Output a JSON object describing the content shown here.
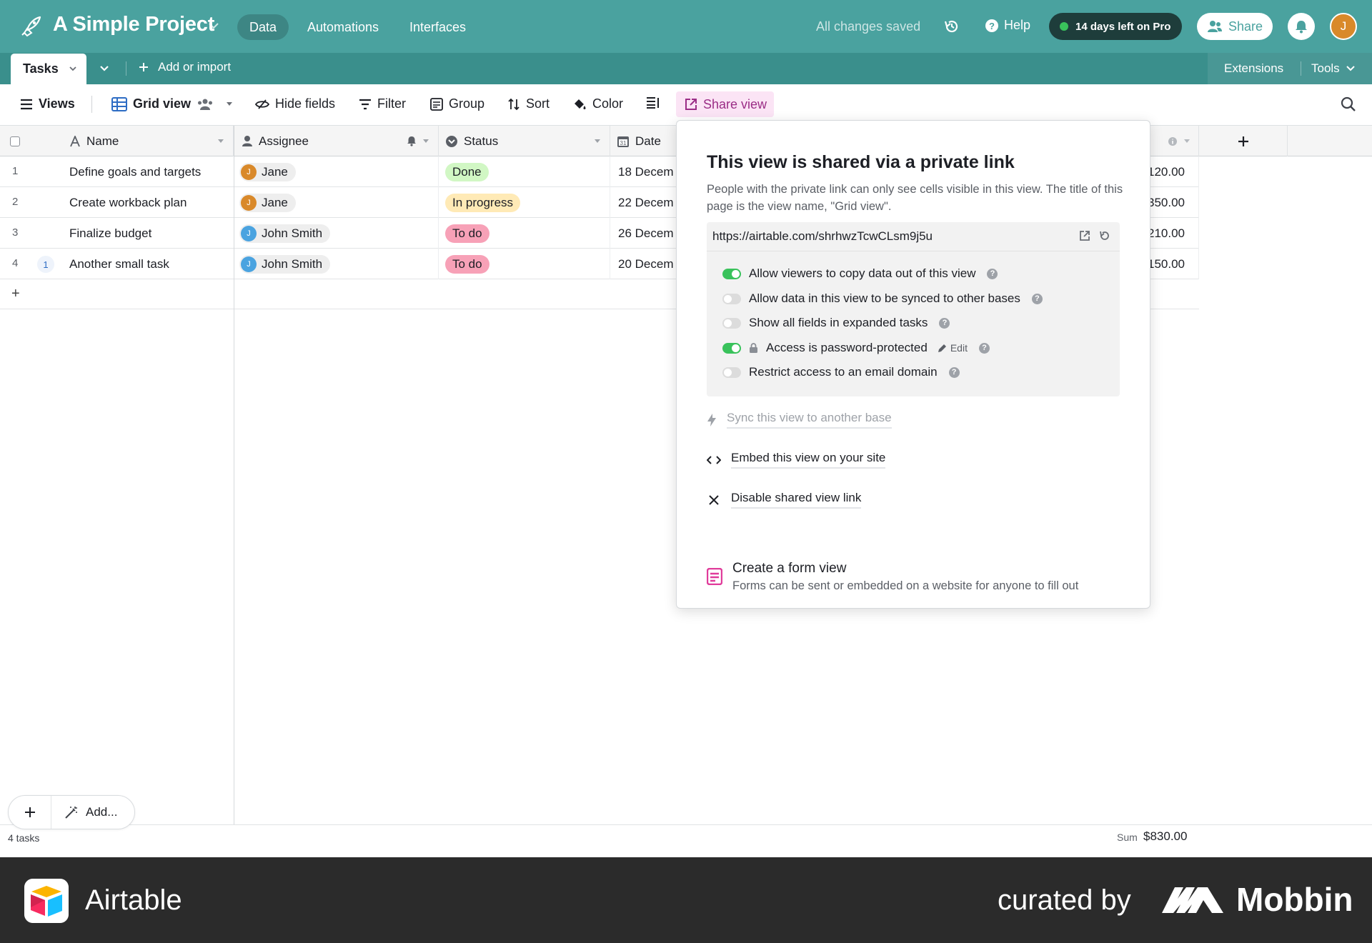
{
  "topbar": {
    "project_title": "A Simple Project",
    "tabs": [
      {
        "label": "Data",
        "active": true
      },
      {
        "label": "Automations",
        "active": false
      },
      {
        "label": "Interfaces",
        "active": false
      }
    ],
    "saved_status": "All changes saved",
    "help_label": "Help",
    "trial_label": "14 days left on Pro",
    "share_label": "Share",
    "user_initial": "J"
  },
  "tablebar": {
    "table_tab": "Tasks",
    "add_import_label": "Add or import",
    "extensions_label": "Extensions",
    "tools_label": "Tools"
  },
  "viewbar": {
    "views_label": "Views",
    "grid_view_label": "Grid view",
    "hide_fields_label": "Hide fields",
    "filter_label": "Filter",
    "group_label": "Group",
    "sort_label": "Sort",
    "color_label": "Color",
    "share_view_label": "Share view"
  },
  "grid": {
    "columns": {
      "name": "Name",
      "assignee": "Assignee",
      "status": "Status",
      "date": "Date"
    },
    "rows": [
      {
        "num": "1",
        "name": "Define goals and targets",
        "assignee": "Jane",
        "assignee_initial": "J",
        "status": "Done",
        "date": "18 Decem",
        "amount": "120.00",
        "comments": ""
      },
      {
        "num": "2",
        "name": "Create workback plan",
        "assignee": "Jane",
        "assignee_initial": "J",
        "status": "In progress",
        "date": "22 Decem",
        "amount": "350.00",
        "comments": ""
      },
      {
        "num": "3",
        "name": "Finalize budget",
        "assignee": "John Smith",
        "assignee_initial": "J",
        "status": "To do",
        "date": "26 Decem",
        "amount": "210.00",
        "comments": ""
      },
      {
        "num": "4",
        "name": "Another small task",
        "assignee": "John Smith",
        "assignee_initial": "J",
        "status": "To do",
        "date": "20 Decem",
        "amount": "150.00",
        "comments": "1"
      }
    ],
    "add_row_symbol": "+",
    "add_button_label": "Add...",
    "task_count": "4 tasks",
    "sum_label": "Sum",
    "sum_value": "$830.00"
  },
  "share_popover": {
    "title": "This view is shared via a private link",
    "description": "People with the private link can only see cells visible in this view. The title of this page is the view name, \"Grid view\".",
    "url": "https://airtable.com/shrhwzTcwCLsm9j5u",
    "options": [
      {
        "label": "Allow viewers to copy data out of this view",
        "enabled": true
      },
      {
        "label": "Allow data in this view to be synced to other bases",
        "enabled": false
      },
      {
        "label": "Show all fields in expanded tasks",
        "enabled": false
      },
      {
        "label": "Access is password-protected",
        "enabled": true
      },
      {
        "label": "Restrict access to an email domain",
        "enabled": false
      }
    ],
    "edit_label": "Edit",
    "sync_label": "Sync this view to another base",
    "embed_label": "Embed this view on your site",
    "disable_label": "Disable shared view link",
    "form_title": "Create a form view",
    "form_desc": "Forms can be sent or embedded on a website for anyone to fill out"
  },
  "brand": {
    "app_name": "Airtable",
    "curated_by": "curated by",
    "curator": "Mobbin"
  },
  "colors": {
    "topbar": "#4aa29f",
    "tablebar": "#3a8f8c",
    "status_done": "#d1f7c4",
    "status_in_progress": "#ffeab6",
    "status_todo": "#f7a1b7",
    "avatar_jane": "#d9892a",
    "avatar_john": "#4aa3e0",
    "share_view_bg": "#fbe4f5"
  }
}
